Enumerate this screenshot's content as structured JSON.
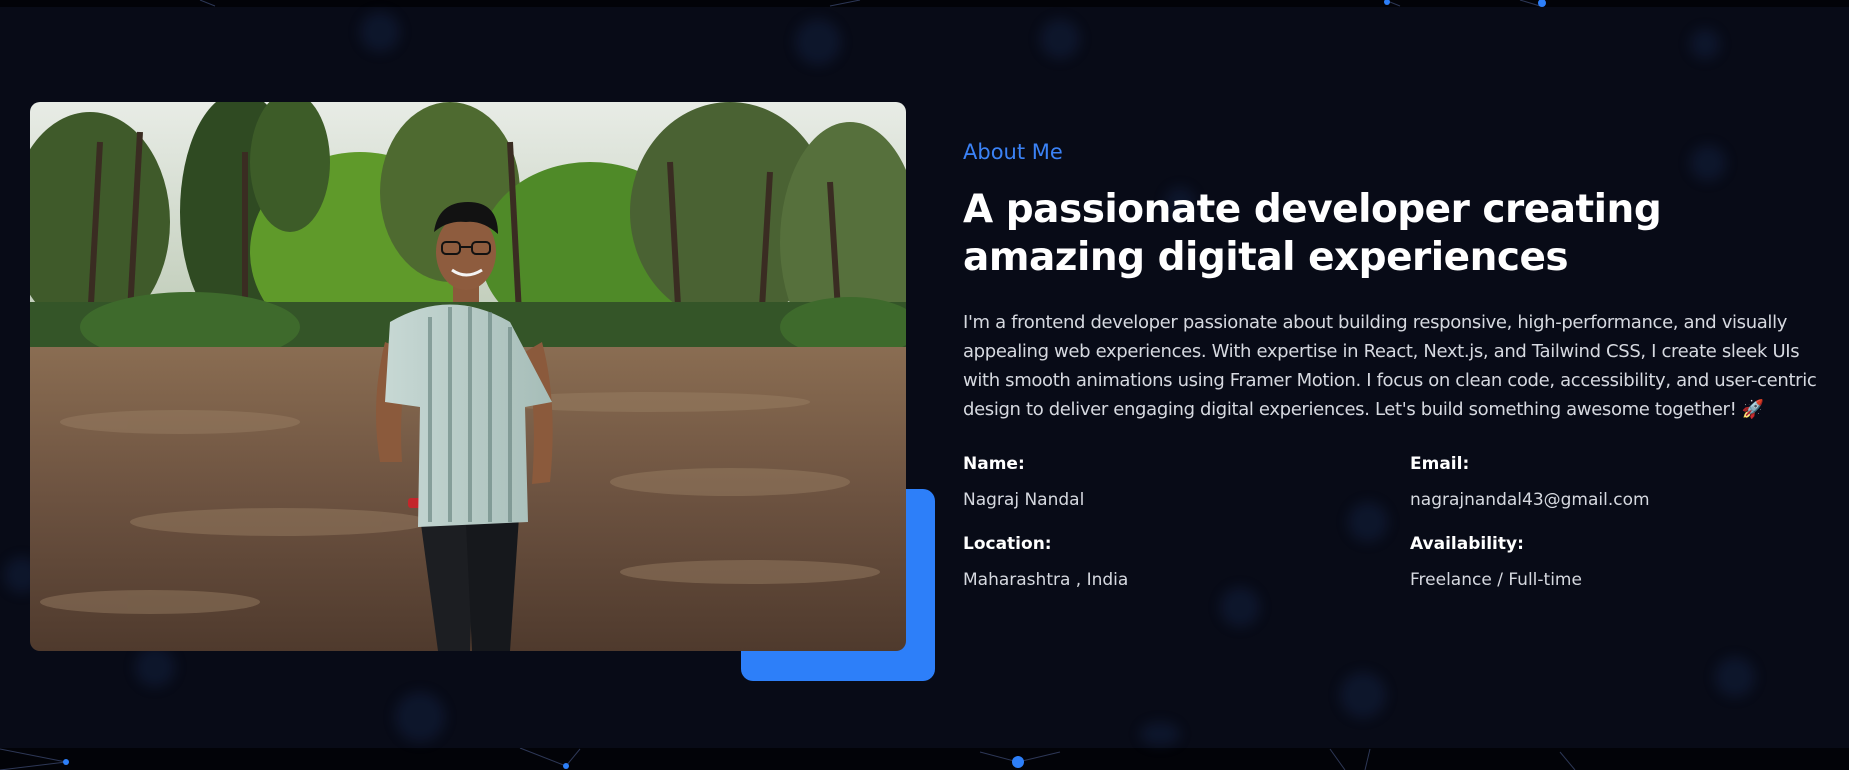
{
  "about": {
    "eyebrow": "About Me",
    "headline": "A passionate developer creating amazing digital experiences",
    "bio": "I'm a frontend developer passionate about building responsive, high-performance, and visually appealing web experiences. With expertise in React, Next.js, and Tailwind CSS, I create sleek UIs with smooth animations using Framer Motion. I focus on clean code, accessibility, and user-centric design to deliver engaging digital experiences. Let's build something awesome together! 🚀",
    "details": [
      {
        "label": "Name:",
        "value": "Nagraj Nandal"
      },
      {
        "label": "Email:",
        "value": "nagrajnandal43@gmail.com"
      },
      {
        "label": "Location:",
        "value": "Maharashtra , India"
      },
      {
        "label": "Availability:",
        "value": "Freelance / Full-time"
      }
    ]
  },
  "colors": {
    "accent": "#2d7ff9",
    "eyebrow": "#3b82f6",
    "section_bg": "#080b17",
    "page_bg": "#020308"
  },
  "photo": {
    "icon": "profile-photo"
  }
}
